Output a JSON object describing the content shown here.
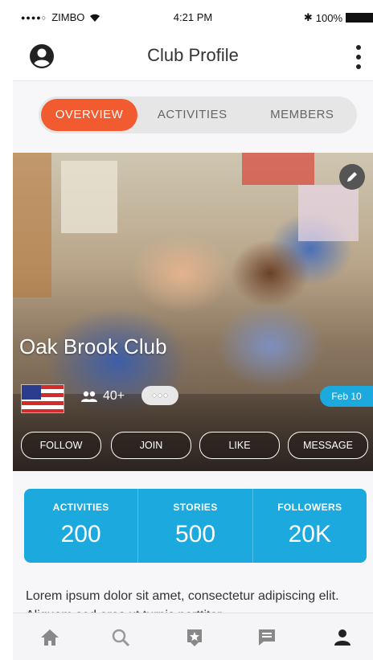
{
  "status_bar": {
    "carrier": "ZIMBO",
    "time": "4:21 PM",
    "battery": "100%"
  },
  "header": {
    "title": "Club Profile"
  },
  "tabs": [
    {
      "label": "OVERVIEW",
      "active": true
    },
    {
      "label": "ACTIVITIES",
      "active": false
    },
    {
      "label": "MEMBERS",
      "active": false
    }
  ],
  "club": {
    "name": "Oak Brook Club",
    "members_count": "40+",
    "date": "Feb 10",
    "country_flag": "us-flag-icon"
  },
  "actions": {
    "follow": "FOLLOW",
    "join": "JOIN",
    "like": "LIKE",
    "message": "MESSAGE"
  },
  "stats": [
    {
      "label": "ACTIVITIES",
      "value": "200"
    },
    {
      "label": "STORIES",
      "value": "500"
    },
    {
      "label": "FOLLOWERS",
      "value": "20K"
    }
  ],
  "description": "Lorem ipsum dolor sit amet, consectetur adipiscing elit. Aliquam sed eros ut turpis porttitor",
  "bottom_nav": [
    "home-icon",
    "search-icon",
    "star-badge-icon",
    "chat-icon",
    "profile-icon"
  ],
  "colors": {
    "accent": "#f25a2f",
    "primary": "#1ba9de"
  }
}
